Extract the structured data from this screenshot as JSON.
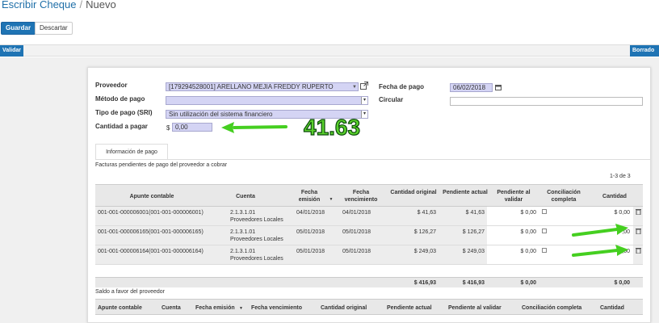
{
  "breadcrumb": {
    "parent": "Escribir Cheque",
    "separator": "/",
    "current": "Nuevo"
  },
  "toolbar": {
    "save_label": "Guardar",
    "discard_label": "Descartar"
  },
  "statusbar": {
    "validate_label": "Validar",
    "state_label": "Borrado"
  },
  "form": {
    "proveedor_label": "Proveedor",
    "proveedor_value": "[179294528001] ARELLANO MEJIA FREDDY RUPERTO",
    "metodo_label": "Método de pago",
    "metodo_value": "",
    "tipo_label": "Tipo de pago (SRI)",
    "tipo_value": "Sin utilización del sistema financiero",
    "cantidad_label": "Cantidad a pagar",
    "currency_symbol": "$",
    "cantidad_value": "0,00",
    "fecha_label": "Fecha de pago",
    "fecha_value": "06/02/2018",
    "circular_label": "Circular",
    "circular_value": ""
  },
  "annotation": {
    "amount_text": "41.63",
    "color": "#5ad12c"
  },
  "tabs": [
    {
      "label": "Información de pago"
    }
  ],
  "section1": {
    "title": "Facturas pendientes de pago del proveedor a cobrar",
    "pager": "1-3 de 3",
    "headers": [
      "Apunte contable",
      "Cuenta",
      "Fecha emisión",
      "Fecha vencimiento",
      "Cantidad original",
      "Pendiente actual",
      "Pendiente al validar",
      "Conciliación completa",
      "Cantidad"
    ],
    "rows": [
      {
        "apunte": "001-001-000006001(001-001-000006001)",
        "cuenta_code": "2.1.3.1.01",
        "cuenta_name": "Proveedores Locales",
        "fecha_emision": "04/01/2018",
        "fecha_venc": "04/01/2018",
        "original": "$ 41,63",
        "actual": "$ 41,63",
        "validar": "$ 0,00",
        "cantidad": "$ 0,00"
      },
      {
        "apunte": "001-001-000006165(001-001-000006165)",
        "cuenta_code": "2.1.3.1.01",
        "cuenta_name": "Proveedores Locales",
        "fecha_emision": "05/01/2018",
        "fecha_venc": "05/01/2018",
        "original": "$ 126,27",
        "actual": "$ 126,27",
        "validar": "$ 0,00",
        "cantidad": ",00"
      },
      {
        "apunte": "001-001-000006164(001-001-000006164)",
        "cuenta_code": "2.1.3.1.01",
        "cuenta_name": "Proveedores Locales",
        "fecha_emision": "05/01/2018",
        "fecha_venc": "05/01/2018",
        "original": "$ 249,03",
        "actual": "$ 249,03",
        "validar": "$ 0,00",
        "cantidad": ",00"
      }
    ],
    "totals": {
      "original": "$ 416,93",
      "actual": "$ 416,93",
      "validar": "$ 0,00",
      "cantidad": "$ 0,00"
    }
  },
  "section2": {
    "title": "Saldo a favor del proveedor",
    "headers": [
      "Apunte contable",
      "Cuenta",
      "Fecha emisión",
      "Fecha vencimiento",
      "Cantidad original",
      "Pendiente actual",
      "Pendiente al validar",
      "Conciliación completa",
      "Cantidad"
    ]
  },
  "icons": {
    "external": "external-link-icon",
    "calendar": "calendar-icon",
    "trash": "trash-icon",
    "sort": "sort-desc-icon"
  }
}
